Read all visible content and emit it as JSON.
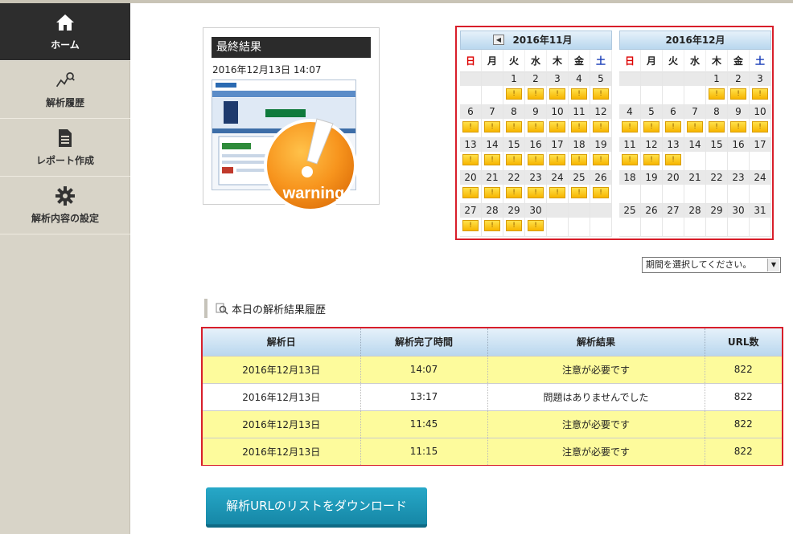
{
  "sidebar": {
    "items": [
      {
        "label": "ホーム",
        "icon": "home-icon",
        "active": true
      },
      {
        "label": "解析履歴",
        "icon": "analysis-history-icon",
        "active": false
      },
      {
        "label": "レポート作成",
        "icon": "report-icon",
        "active": false
      },
      {
        "label": "解析内容の設定",
        "icon": "gear-icon",
        "active": false
      }
    ]
  },
  "result": {
    "title": "最終結果",
    "timestamp": "2016年12月13日 14:07",
    "badge_text": "warning"
  },
  "calendar": {
    "months": [
      {
        "title": "2016年11月"
      },
      {
        "title": "2016年12月"
      }
    ],
    "weekdays": [
      "日",
      "月",
      "火",
      "水",
      "木",
      "金",
      "土"
    ],
    "warning_mark": "!"
  },
  "period_select": {
    "selected": "期間を選択してください。"
  },
  "history": {
    "heading": "本日の解析結果履歴",
    "columns": [
      "解析日",
      "解析完了時間",
      "解析結果",
      "URL数"
    ],
    "rows": [
      {
        "date": "2016年12月13日",
        "time": "14:07",
        "result": "注意が必要です",
        "urls": "822"
      },
      {
        "date": "2016年12月13日",
        "time": "13:17",
        "result": "問題はありませんでした",
        "urls": "822"
      },
      {
        "date": "2016年12月13日",
        "time": "11:45",
        "result": "注意が必要です",
        "urls": "822"
      },
      {
        "date": "2016年12月13日",
        "time": "11:15",
        "result": "注意が必要です",
        "urls": "822"
      }
    ]
  },
  "download": {
    "label": "解析URLのリストをダウンロード"
  },
  "colors": {
    "highlight_border": "#d81e2a",
    "warning_row": "#fdfb9c",
    "button": "#1b95b6",
    "sidebar_active": "#2d2d2d"
  }
}
